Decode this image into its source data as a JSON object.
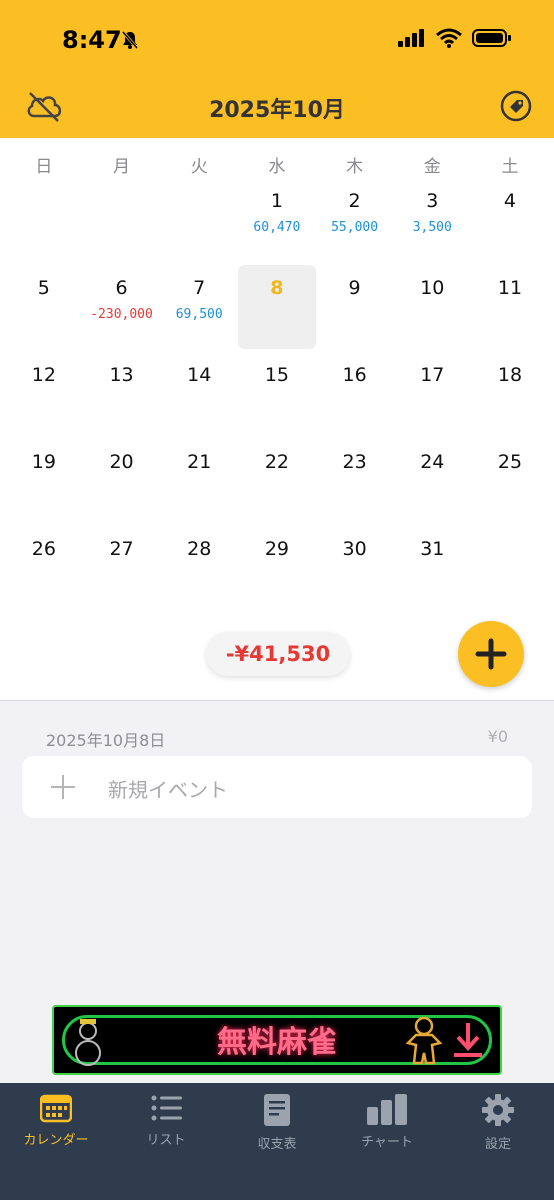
{
  "status": {
    "time": "8:47"
  },
  "header": {
    "title": "2025年10月"
  },
  "weekdays": [
    "日",
    "月",
    "火",
    "水",
    "木",
    "金",
    "土"
  ],
  "weeks": [
    [
      {
        "d": ""
      },
      {
        "d": ""
      },
      {
        "d": ""
      },
      {
        "d": "1",
        "amt": "60,470",
        "sign": "pos"
      },
      {
        "d": "2",
        "amt": "55,000",
        "sign": "pos"
      },
      {
        "d": "3",
        "amt": "3,500",
        "sign": "pos"
      },
      {
        "d": "4"
      }
    ],
    [
      {
        "d": "5"
      },
      {
        "d": "6",
        "amt": "-230,000",
        "sign": "neg"
      },
      {
        "d": "7",
        "amt": "69,500",
        "sign": "pos"
      },
      {
        "d": "8",
        "today": true
      },
      {
        "d": "9"
      },
      {
        "d": "10"
      },
      {
        "d": "11"
      }
    ],
    [
      {
        "d": "12"
      },
      {
        "d": "13"
      },
      {
        "d": "14"
      },
      {
        "d": "15"
      },
      {
        "d": "16"
      },
      {
        "d": "17"
      },
      {
        "d": "18"
      }
    ],
    [
      {
        "d": "19"
      },
      {
        "d": "20"
      },
      {
        "d": "21"
      },
      {
        "d": "22"
      },
      {
        "d": "23"
      },
      {
        "d": "24"
      },
      {
        "d": "25"
      }
    ],
    [
      {
        "d": "26"
      },
      {
        "d": "27"
      },
      {
        "d": "28"
      },
      {
        "d": "29"
      },
      {
        "d": "30"
      },
      {
        "d": "31"
      },
      {
        "d": ""
      }
    ]
  ],
  "summary": {
    "total": "-¥41,530"
  },
  "selected_day": {
    "date": "2025年10月8日",
    "total": "¥0",
    "new_event_label": "新規イベント"
  },
  "ad": {
    "text": "無料麻雀"
  },
  "tabs": [
    {
      "label": "カレンダー",
      "icon": "calendar-icon",
      "active": true
    },
    {
      "label": "リスト",
      "icon": "list-icon"
    },
    {
      "label": "収支表",
      "icon": "document-icon"
    },
    {
      "label": "チャート",
      "icon": "bar-chart-icon"
    },
    {
      "label": "設定",
      "icon": "gear-icon"
    }
  ],
  "colors": {
    "accent": "#fbbf24",
    "positive": "#1e90d6",
    "negative": "#e53935",
    "tabbar": "#2f3c4e"
  }
}
